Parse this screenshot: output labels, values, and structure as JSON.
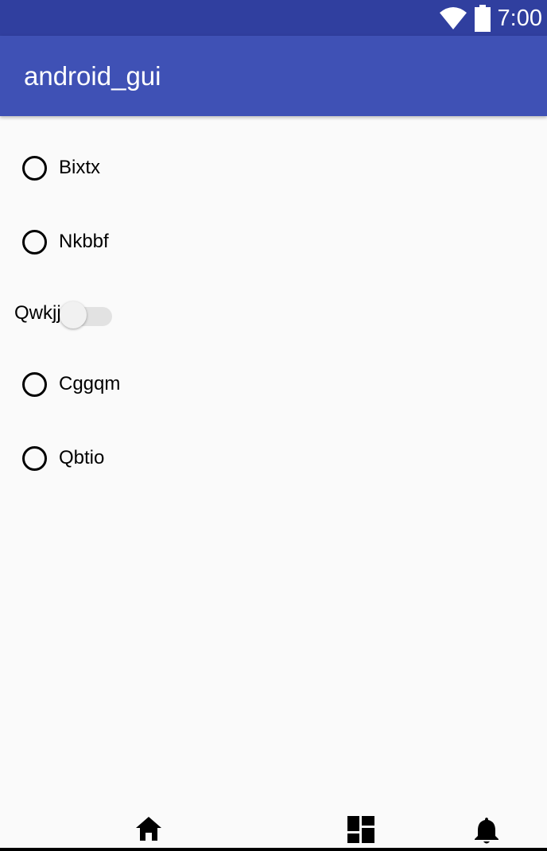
{
  "status_bar": {
    "time": "7:00",
    "icons": [
      "wifi-icon",
      "battery-icon"
    ],
    "background": "#303f9f"
  },
  "app_bar": {
    "title": "android_gui",
    "background": "#3f51b5"
  },
  "options": {
    "items": [
      {
        "type": "radio",
        "label": "Bixtx",
        "checked": false
      },
      {
        "type": "radio",
        "label": "Nkbbf",
        "checked": false
      },
      {
        "type": "switch",
        "label": "Qwkjj",
        "on": false
      },
      {
        "type": "radio",
        "label": "Cggqm",
        "checked": false
      },
      {
        "type": "radio",
        "label": "Qbtio",
        "checked": false
      }
    ]
  },
  "bottom_nav": {
    "icons": [
      "home-icon",
      "dashboard-icon",
      "notifications-icon"
    ]
  }
}
